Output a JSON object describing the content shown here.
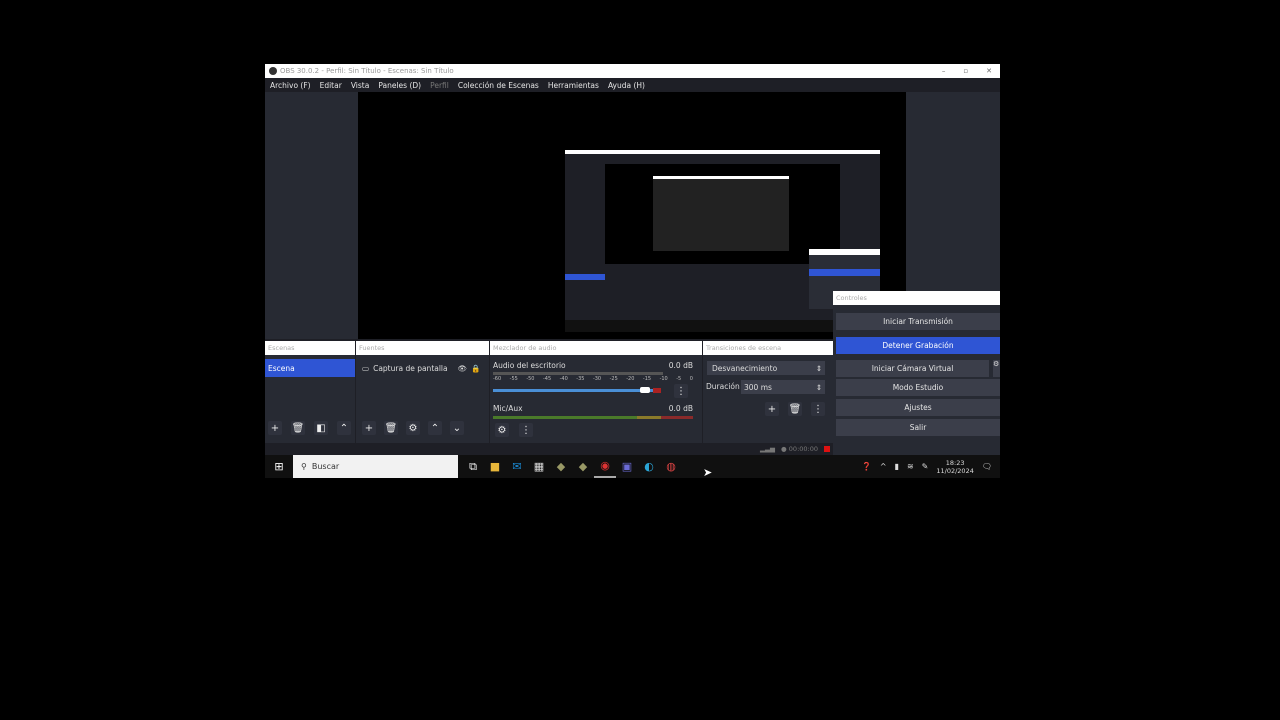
{
  "window": {
    "title": "OBS 30.0.2 - Perfil: Sin Título - Escenas: Sin Título"
  },
  "menu": [
    "Archivo (F)",
    "Editar",
    "Vista",
    "Paneles (D)",
    "Perfil",
    "Colección de Escenas",
    "Herramientas",
    "Ayuda (H)"
  ],
  "scenes": {
    "header": "Escenas",
    "items": [
      "Escena"
    ]
  },
  "sources": {
    "header": "Fuentes",
    "items": [
      "Captura de pantalla"
    ]
  },
  "mixer": {
    "header": "Mezclador de audio",
    "channels": [
      {
        "name": "Audio del escritorio",
        "level": "0.0 dB",
        "volume": 0.95
      },
      {
        "name": "Mic/Aux",
        "level": "0.0 dB"
      }
    ],
    "ticks": [
      "-60",
      "-55",
      "-50",
      "-45",
      "-40",
      "-35",
      "-30",
      "-25",
      "-20",
      "-15",
      "-10",
      "-5",
      "0"
    ]
  },
  "transitions": {
    "header": "Transiciones de escena",
    "selected": "Desvanecimiento",
    "duration_label": "Duración",
    "duration": "300 ms"
  },
  "controls": {
    "header": "Controles",
    "buttons": [
      "Iniciar Transmisión",
      "Detener Grabación",
      "Iniciar Cámara Virtual",
      "Modo Estudio",
      "Ajustes",
      "Salir"
    ]
  },
  "status": {
    "rec_time": "00:00:00"
  },
  "taskbar": {
    "search_placeholder": "Buscar",
    "time": "18:23",
    "date": "11/02/2024"
  },
  "colors": {
    "accent": "#2f55d4",
    "rec": "#d11"
  }
}
